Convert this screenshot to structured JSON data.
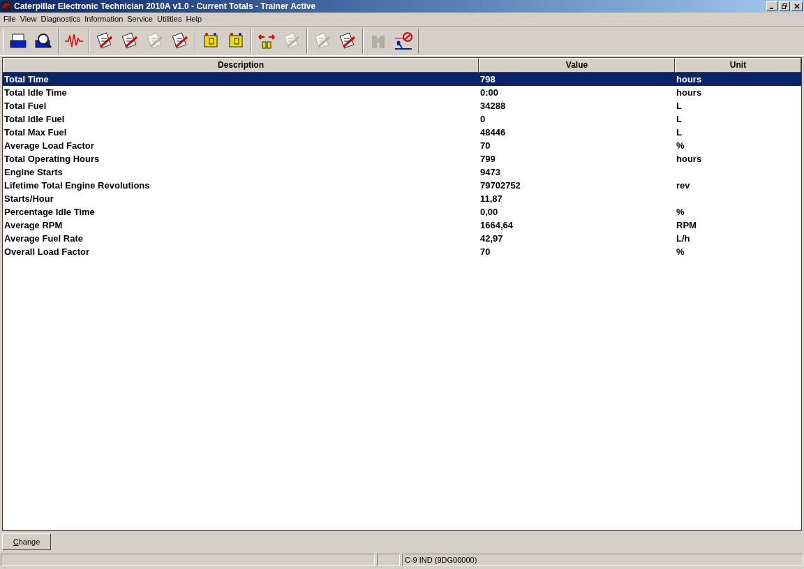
{
  "window": {
    "title": "Caterpillar Electronic Technician 2010A v1.0 - Current Totals - Trainer Active"
  },
  "menu": [
    "File",
    "View",
    "Diagnostics",
    "Information",
    "Service",
    "Utilities",
    "Help"
  ],
  "toolbar": [
    [
      {
        "disabled": false
      },
      {
        "disabled": false
      }
    ],
    [
      {
        "disabled": false
      }
    ],
    [
      {
        "disabled": false
      },
      {
        "disabled": false
      },
      {
        "disabled": true
      },
      {
        "disabled": false
      }
    ],
    [
      {
        "disabled": false
      },
      {
        "disabled": false
      }
    ],
    [
      {
        "disabled": false
      },
      {
        "disabled": true
      }
    ],
    [
      {
        "disabled": true
      },
      {
        "disabled": false
      }
    ],
    [
      {
        "disabled": true
      },
      {
        "disabled": false
      }
    ]
  ],
  "table": {
    "columns": [
      "Description",
      "Value",
      "Unit"
    ],
    "rows": [
      {
        "cells": [
          "Total Time",
          "798",
          "hours"
        ],
        "selected": true
      },
      {
        "cells": [
          "Total Idle Time",
          "0:00",
          "hours"
        ],
        "selected": false
      },
      {
        "cells": [
          "Total Fuel",
          "34288",
          "L"
        ],
        "selected": false
      },
      {
        "cells": [
          "Total Idle Fuel",
          "0",
          "L"
        ],
        "selected": false
      },
      {
        "cells": [
          "Total Max Fuel",
          "48446",
          "L"
        ],
        "selected": false
      },
      {
        "cells": [
          "Average Load Factor",
          "70",
          "%"
        ],
        "selected": false
      },
      {
        "cells": [
          "Total Operating Hours",
          "799",
          "hours"
        ],
        "selected": false
      },
      {
        "cells": [
          "Engine Starts",
          "9473"
        ],
        "selected": false
      },
      {
        "cells": [
          "Lifetime Total Engine Revolutions",
          "79702752",
          "rev"
        ],
        "selected": false
      },
      {
        "cells": [
          "Starts/Hour",
          "11,87"
        ],
        "selected": false
      },
      {
        "cells": [
          "Percentage Idle Time",
          "0,00",
          "%"
        ],
        "selected": false
      },
      {
        "cells": [
          "Average RPM",
          "1664,64",
          "RPM"
        ],
        "selected": false
      },
      {
        "cells": [
          "Average Fuel Rate",
          "42,97",
          "L/h"
        ],
        "selected": false
      },
      {
        "cells": [
          "Overall Load Factor",
          "70",
          "%"
        ],
        "selected": false
      }
    ]
  },
  "buttons": [
    "Change"
  ],
  "status_bar": {
    "ecm": "C-9 IND (9DG00000)"
  }
}
